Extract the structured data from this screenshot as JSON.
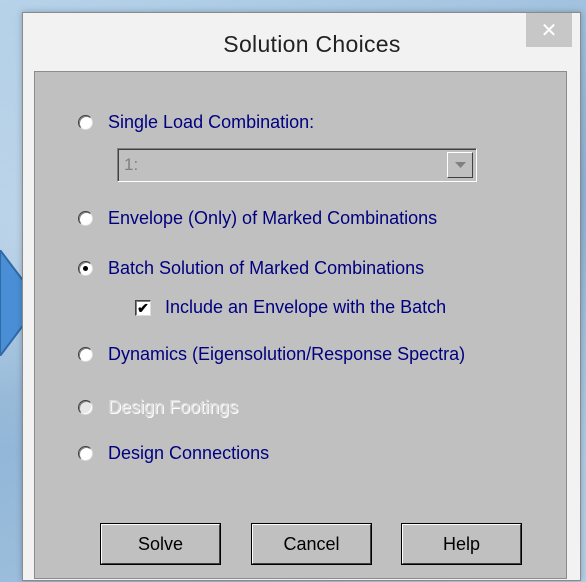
{
  "window": {
    "title": "Solution Choices",
    "close_label": "✕"
  },
  "options": {
    "single": {
      "label": "Single Load Combination:",
      "selected": false
    },
    "combo": {
      "value": "1:"
    },
    "envelope": {
      "label": "Envelope (Only) of Marked Combinations",
      "selected": false
    },
    "batch": {
      "label": "Batch Solution of Marked Combinations",
      "selected": true
    },
    "include_envelope": {
      "label": "Include an Envelope with the Batch",
      "checked": true,
      "check_glyph": "✔"
    },
    "dynamics": {
      "label": "Dynamics (Eigensolution/Response Spectra)",
      "selected": false
    },
    "footings": {
      "label": "Design Footings",
      "selected": false,
      "disabled": true
    },
    "connections": {
      "label": "Design Connections",
      "selected": false
    }
  },
  "buttons": {
    "solve": "Solve",
    "cancel": "Cancel",
    "help": "Help"
  },
  "colors": {
    "dialog_face": "#c0c0c0",
    "label_text": "#000080",
    "disabled_text": "#dcdcdc",
    "arrow_fill": "#4a8fd6"
  }
}
